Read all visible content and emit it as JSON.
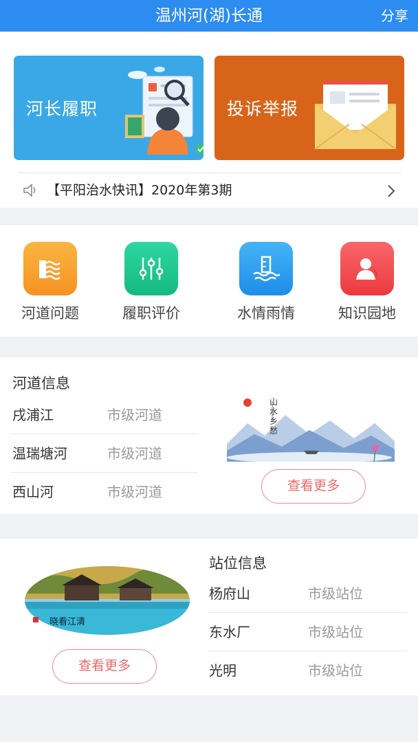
{
  "header": {
    "title": "温州河(湖)长通",
    "share_label": "分享"
  },
  "banners": [
    {
      "label": "河长履职",
      "color": "#3aa8e6"
    },
    {
      "label": "投诉举报",
      "color": "#d8641a"
    }
  ],
  "notice": {
    "text": "【平阳治水快讯】2020年第3期"
  },
  "quick_actions": [
    {
      "label": "河道问题",
      "icon": "river-problem-icon",
      "color": "#f9a531"
    },
    {
      "label": "履职评价",
      "icon": "sliders-icon",
      "color": "#1ec88f"
    },
    {
      "label": "水情雨情",
      "icon": "water-gauge-icon",
      "color": "#2b9cf0"
    },
    {
      "label": "知识园地",
      "icon": "person-phone-icon",
      "color": "#f0494c"
    }
  ],
  "river_info": {
    "title": "河道信息",
    "rows": [
      {
        "name": "戌浦江",
        "level": "市级河道"
      },
      {
        "name": "温瑞塘河",
        "level": "市级河道"
      },
      {
        "name": "西山河",
        "level": "市级河道"
      }
    ],
    "image_caption": "山水乡愁",
    "more_label": "查看更多"
  },
  "station_info": {
    "title": "站位信息",
    "rows": [
      {
        "name": "杨府山",
        "level": "市级站位"
      },
      {
        "name": "东水厂",
        "level": "市级站位"
      },
      {
        "name": "光明",
        "level": "市级站位"
      }
    ],
    "image_caption": "晓看江清",
    "more_label": "查看更多"
  },
  "colors": {
    "primary": "#2c8cf0",
    "accent_red": "#ea6a6a"
  }
}
